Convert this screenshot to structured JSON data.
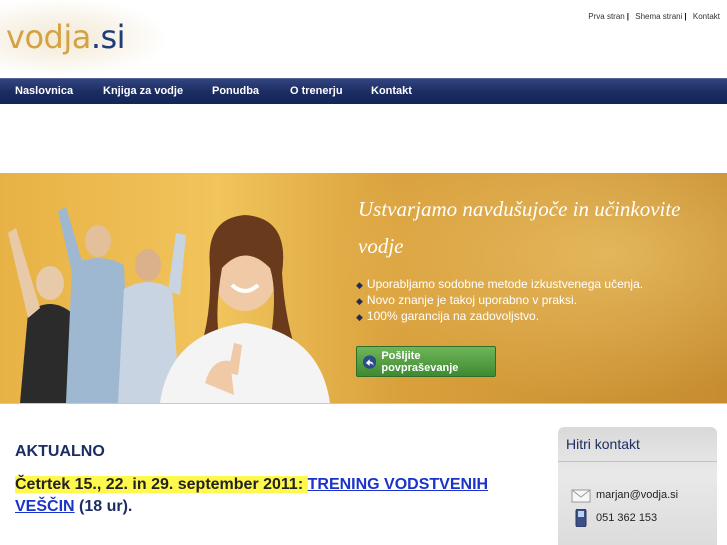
{
  "logo": {
    "part1": "vodja",
    "part2": ".si"
  },
  "top_links": [
    "Prva stran",
    "Shema strani",
    "Kontakt"
  ],
  "nav": [
    "Naslovnica",
    "Knjiga za vodje",
    "Ponudba",
    "O trenerju",
    "Kontakt"
  ],
  "banner": {
    "title": "Ustvarjamo navdušujoče in učinkovite vodje",
    "bullets": [
      "Uporabljamo sodobne metode izkustvenega učenja.",
      "Novo znanje je takoj uporabno v praksi.",
      "100% garancija na zadovoljstvo."
    ],
    "cta_label": "Pošljite povpraševanje"
  },
  "news": {
    "heading": "AKTUALNO",
    "date_text": "Četrtek 15., 22. in 29. september 2011: ",
    "link_text": "TRENING VODSTVENIH VEŠČIN",
    "suffix": " (18 ur)."
  },
  "quick_contact": {
    "title": "Hitri kontakt",
    "email": "marjan@vodja.si",
    "phone": "051 362 153"
  },
  "colors": {
    "nav_bg": "#1c2d63",
    "accent_gold": "#d5a243",
    "cta_green": "#4f9d3f",
    "highlight": "#fff94d"
  }
}
